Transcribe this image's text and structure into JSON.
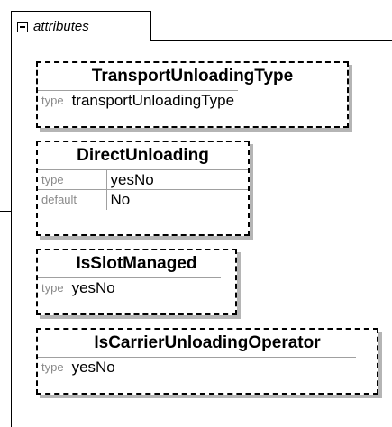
{
  "group": {
    "label": "attributes",
    "icon": "minus-box-icon"
  },
  "attributes": [
    {
      "name": "TransportUnloadingType",
      "props": [
        {
          "key": "type",
          "value": "transportUnloadingType"
        }
      ]
    },
    {
      "name": "DirectUnloading",
      "props": [
        {
          "key": "type",
          "value": "yesNo"
        },
        {
          "key": "default",
          "value": "No"
        }
      ]
    },
    {
      "name": "IsSlotManaged",
      "props": [
        {
          "key": "type",
          "value": "yesNo"
        }
      ]
    },
    {
      "name": "IsCarrierUnloadingOperator",
      "props": [
        {
          "key": "type",
          "value": "yesNo"
        }
      ]
    }
  ]
}
